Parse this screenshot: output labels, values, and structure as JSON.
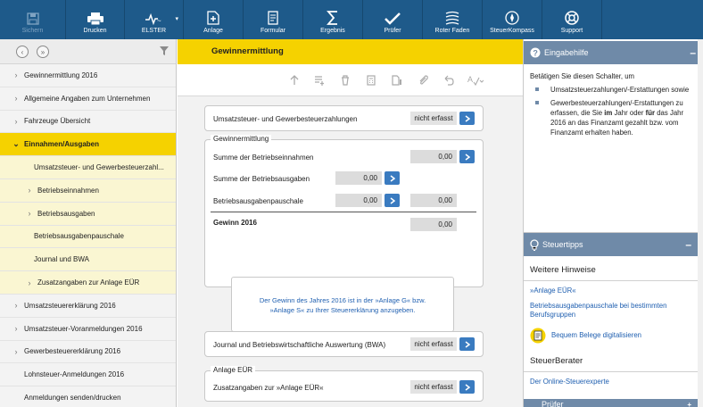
{
  "toolbar": {
    "items": [
      {
        "label": "Sichern",
        "icon": "save-icon",
        "enabled": false
      },
      {
        "label": "Drucken",
        "icon": "printer-icon",
        "enabled": true
      },
      {
        "label": "ELSTER",
        "icon": "elster-icon",
        "enabled": true
      },
      {
        "label": "Anlage",
        "icon": "add-document-icon",
        "enabled": true
      },
      {
        "label": "Formular",
        "icon": "form-icon",
        "enabled": true
      },
      {
        "label": "Ergebnis",
        "icon": "sum-icon",
        "enabled": true
      },
      {
        "label": "Prüfer",
        "icon": "checkmark-icon",
        "enabled": true
      },
      {
        "label": "Roter Faden",
        "icon": "guide-icon",
        "enabled": true
      },
      {
        "label": "SteuerKompass",
        "icon": "compass-icon",
        "enabled": true
      },
      {
        "label": "Support",
        "icon": "lifebuoy-icon",
        "enabled": true
      }
    ]
  },
  "nav": {
    "items": [
      {
        "label": "Gewinnermittlung 2016",
        "chevron": "›",
        "level": 0
      },
      {
        "label": "Allgemeine Angaben zum Unternehmen",
        "chevron": "›",
        "level": 0
      },
      {
        "label": "Fahrzeuge Übersicht",
        "chevron": "›",
        "level": 0
      },
      {
        "label": "Einnahmen/Ausgaben",
        "chevron": "⌄",
        "level": 0,
        "active": true
      },
      {
        "label": "Umsatzsteuer- und Gewerbesteuerzahl...",
        "chevron": "",
        "level": 1
      },
      {
        "label": "Betriebseinnahmen",
        "chevron": "›",
        "level": 1
      },
      {
        "label": "Betriebsausgaben",
        "chevron": "›",
        "level": 1
      },
      {
        "label": "Betriebsausgabenpauschale",
        "chevron": "",
        "level": 1
      },
      {
        "label": "Journal und BWA",
        "chevron": "",
        "level": 1
      },
      {
        "label": "Zusatzangaben zur Anlage EÜR",
        "chevron": "›",
        "level": 1
      },
      {
        "label": "Umsatzsteuererklärung 2016",
        "chevron": "›",
        "level": 0
      },
      {
        "label": "Umsatzsteuer-Voranmeldungen 2016",
        "chevron": "›",
        "level": 0
      },
      {
        "label": "Gewerbesteuererklärung 2016",
        "chevron": "›",
        "level": 0
      },
      {
        "label": "Lohnsteuer-Anmeldungen 2016",
        "chevron": "",
        "level": 0
      },
      {
        "label": "Anmeldungen senden/drucken",
        "chevron": "",
        "level": 0
      }
    ]
  },
  "main": {
    "title": "Gewinnermittlung",
    "ust_row": {
      "label": "Umsatzsteuer- und Gewerbesteuerzahlungen",
      "status": "nicht erfasst"
    },
    "gewinn": {
      "legend": "Gewinnermittlung",
      "einnahmen_label": "Summe der Betriebseinnahmen",
      "einnahmen_value": "0,00",
      "ausgaben_label": "Summe der Betriebsausgaben",
      "ausgaben_value": "0,00",
      "pauschale_label": "Betriebsausgabenpauschale",
      "pauschale_value1": "0,00",
      "pauschale_value2": "0,00",
      "gewinn_label": "Gewinn 2016",
      "gewinn_value": "0,00"
    },
    "note_line1": "Der Gewinn des Jahres 2016 ist in der »Anlage G« bzw.",
    "note_line2": "»Anlage S« zu Ihrer Steuererklärung anzugeben.",
    "journal_row": {
      "label": "Journal und Betriebswirtschaftliche Auswertung (BWA)",
      "status": "nicht erfasst"
    },
    "anlage": {
      "legend": "Anlage EÜR",
      "label": "Zusatzangaben zur »Anlage EÜR«",
      "status": "nicht erfasst"
    }
  },
  "help": {
    "title": "Eingabehilfe",
    "intro": "Betätigen Sie diesen Schalter, um",
    "bullet1": "Umsatzsteuerzahlungen/-Erstattungen sowie",
    "bullet2_a": "Gewerbesteuerzahlungen/-Erstattungen zu erfassen, die Sie ",
    "bullet2_b": "im",
    "bullet2_c": " Jahr oder ",
    "bullet2_d": "für",
    "bullet2_e": " das Jahr 2016 an das Finanzamt gezahlt bzw. vom Finanzamt erhalten haben."
  },
  "tips": {
    "title": "Steuertipps",
    "section1": "Weitere Hinweise",
    "link1": "»Anlage EÜR«",
    "link2": "Betriebsausgabenpauschale bei bestimmten Berufsgruppen",
    "link3": "Bequem Belege digitalisieren",
    "section2": "SteuerBerater",
    "link4": "Der Online-Steuerexperte",
    "bottom": "Prüfer"
  },
  "colors": {
    "toolbar": "#1e5a8a",
    "accent_yellow": "#f5d200",
    "panel_head": "#6f8aa8",
    "button_blue": "#3a7bc0"
  }
}
